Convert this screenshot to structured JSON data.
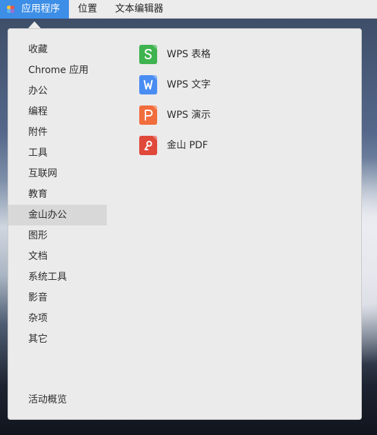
{
  "top_bar": {
    "apps_label": "应用程序",
    "places_label": "位置",
    "editor_label": "文本编辑器"
  },
  "categories": [
    {
      "label": "收藏",
      "active": false
    },
    {
      "label": "Chrome 应用",
      "active": false
    },
    {
      "label": "办公",
      "active": false
    },
    {
      "label": "编程",
      "active": false
    },
    {
      "label": "附件",
      "active": false
    },
    {
      "label": "工具",
      "active": false
    },
    {
      "label": "互联网",
      "active": false
    },
    {
      "label": "教育",
      "active": false
    },
    {
      "label": "金山办公",
      "active": true
    },
    {
      "label": "图形",
      "active": false
    },
    {
      "label": "文档",
      "active": false
    },
    {
      "label": "系统工具",
      "active": false
    },
    {
      "label": "影音",
      "active": false
    },
    {
      "label": "杂项",
      "active": false
    },
    {
      "label": "其它",
      "active": false
    }
  ],
  "apps": [
    {
      "label": "WPS 表格",
      "icon": "wps-spreadsheet-icon",
      "color": "#3fb34f"
    },
    {
      "label": "WPS 文字",
      "icon": "wps-writer-icon",
      "color": "#4a8df2"
    },
    {
      "label": "WPS 演示",
      "icon": "wps-presentation-icon",
      "color": "#f26d3d"
    },
    {
      "label": "金山 PDF",
      "icon": "kingsoft-pdf-icon",
      "color": "#e0483a"
    }
  ],
  "overview_label": "活动概览"
}
